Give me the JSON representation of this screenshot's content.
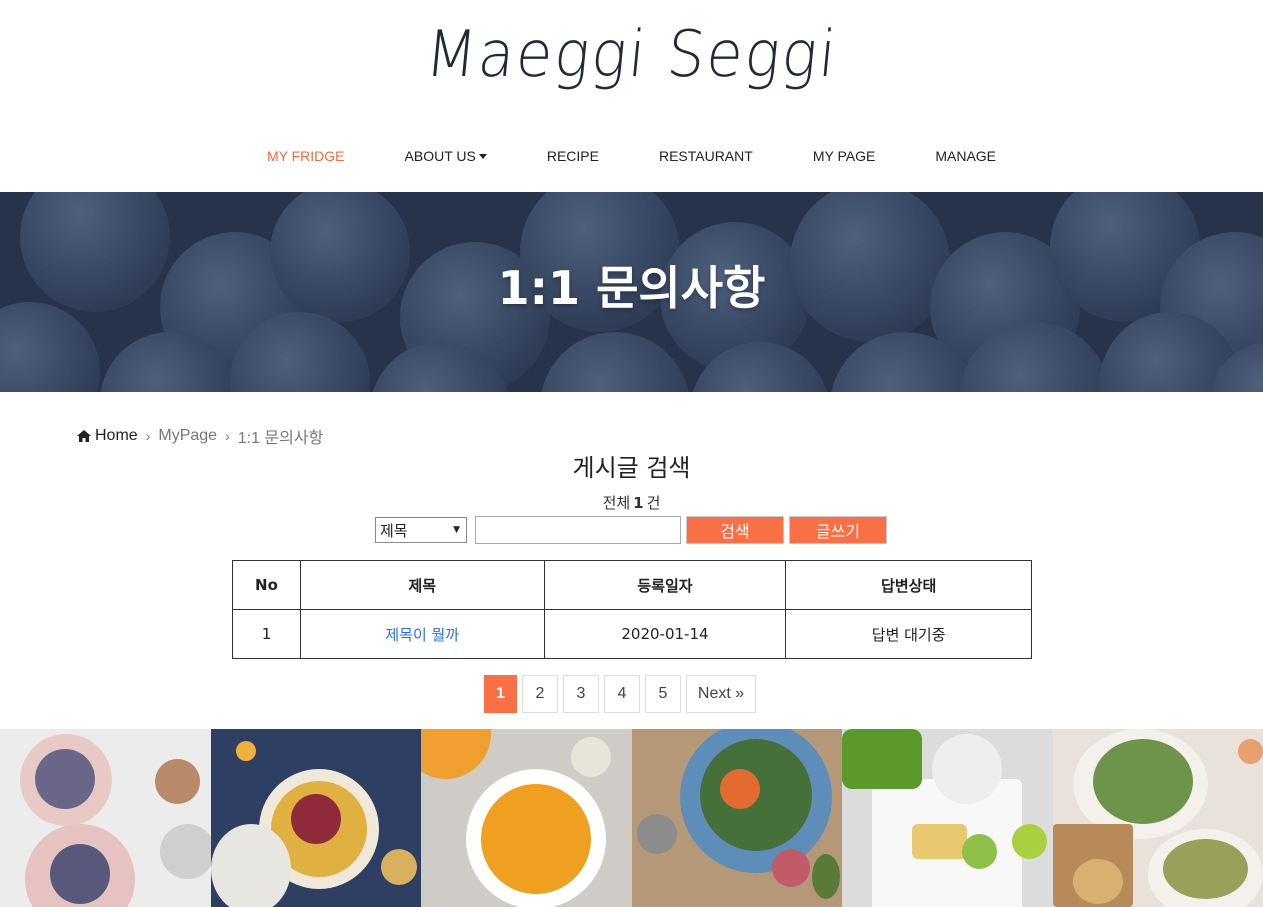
{
  "logo": "Maeggi Seggi",
  "nav": {
    "items": [
      {
        "label": "MY FRIDGE",
        "active": true
      },
      {
        "label": "ABOUT US",
        "dropdown": true
      },
      {
        "label": "RECIPE"
      },
      {
        "label": "RESTAURANT"
      },
      {
        "label": "MY PAGE"
      },
      {
        "label": "MANAGE"
      }
    ]
  },
  "hero": {
    "title": "1:1 문의사항"
  },
  "breadcrumb": {
    "home": "Home",
    "items": [
      "MyPage",
      "1:1 문의사항"
    ]
  },
  "board": {
    "title": "게시글 검색",
    "total_prefix": "전체",
    "total_count": "1",
    "total_suffix": "건",
    "search": {
      "field_selected": "제목",
      "query": "",
      "search_label": "검색",
      "write_label": "글쓰기"
    },
    "columns": [
      "No",
      "제목",
      "등록일자",
      "답변상태"
    ],
    "rows": [
      {
        "no": "1",
        "title": "제목이 뭘까",
        "date": "2020-01-14",
        "status": "답변 대기중"
      }
    ]
  },
  "pagination": {
    "pages": [
      "1",
      "2",
      "3",
      "4",
      "5"
    ],
    "current": "1",
    "next": "Next »"
  },
  "colors": {
    "accent": "#f97046",
    "nav_active": "#f06a40",
    "link": "#2a73d6"
  }
}
